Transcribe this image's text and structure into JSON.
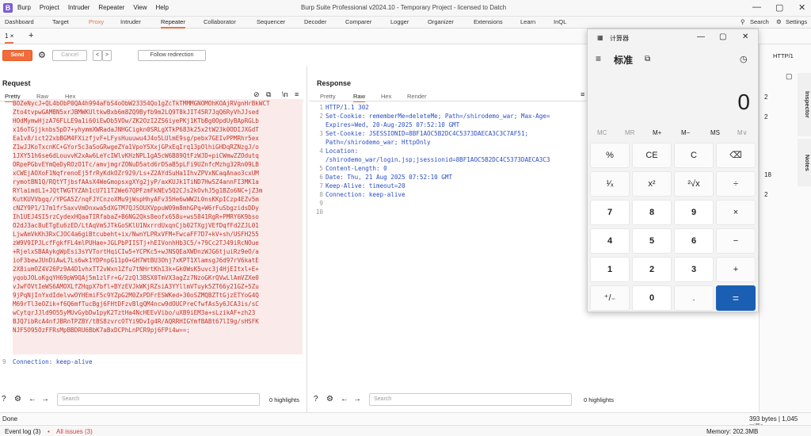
{
  "app": {
    "logo": "B",
    "menu": [
      "Burp",
      "Project",
      "Intruder",
      "Repeater",
      "View",
      "Help"
    ],
    "title": "Burp Suite Professional v2024.10 - Temporary Project - licensed to Datch",
    "minimize": "—",
    "maximize": "▢",
    "close": "✕"
  },
  "main_tabs": [
    "Dashboard",
    "Target",
    "Proxy",
    "Intruder",
    "Repeater",
    "Collaborator",
    "Sequencer",
    "Decoder",
    "Comparer",
    "Logger",
    "Organizer",
    "Extensions",
    "Learn",
    "InQL"
  ],
  "search_label": "Search",
  "settings_label": "Settings",
  "repeater_tab": {
    "label": "1 ×",
    "add": "+"
  },
  "toolbar": {
    "send": "Send",
    "cancel": "Cancel",
    "prev": "<",
    "next": ">",
    "follow": "Follow redirection",
    "http": "HTTP/1"
  },
  "request": {
    "title": "Request",
    "tabs": [
      "Pretty",
      "Raw",
      "Hex"
    ],
    "lines": [
      "BOZeNycJ+QL4bObP0QA4h994aFbS4oObW23354Qo1gZcTkTMMMGNOMOhKOAjRVgnHrBkWCT",
      "Zto4tvpwGAMBN5xrJBMWKUltkwBxb6m8ZQ9Byfb9m2LQ9T8kJIT45R7JqQ6RyVhJJsed",
      "HOdMymwHjzA76FLLE9a1i60iEwDb5VOw/ZK2OzI2ZS6iyePKj1KTbBg0OpdUyBApRGLb",
      "x16oTGjjknbs5pD7+yhymmXWRadaJNHGCigkn0SRLgXTkP683k25x2tW23k0ODIJXGdT",
      "Ea1v8/ict22xbBGM4FXizfjvF+LFysHuuuwu4J4o5LUlmE9sg/pebx7GEIvPPMRhr5ex",
      "Z1wJJKoTxcnKC+GYor5c3aSoGRwgeZYa1VpoYSXxjGPxEqIrq13pOlhiGHDqRZNzgJ/o",
      "1JXY51h6se6dLouvvK2xAw6LeYcIWlvKHzNPL1gA5cW6B89QtFzWJD+piCWmwZZOdutq",
      "ORpePGbvEYmQeDyROzO1Tc/amvjmgrZONuD5atd6rDSaB5pLFi9UZnfcMzhg32Rn09LB",
      "xCWEjAOXoF1NqfrenoEj5frRyKdkOZr929/Ls+Z2AYdSuHa1IhvZPVxNCaqAnao3cxUM",
      "rymotBN1Q/RQtYTjbsfAAsX4WeGmopsxgXYg2jyP/axKUJk1TiND7HwSZ4annFI3MK1a",
      "RYlaimdL1+JQtTWGTYZAh1cU711T2We67QPFzmFkNEv5Q2CJs2kOvhJ5g1BZo6NC+jZ3m",
      "KutKUVVbgq//YPGA5Z/nqFJYCnzoXMu9jWspHhyAFv35He6wWW2L0nsKKpICzp4EZv5m",
      "cNZY9P1/17m1fr5axvVmDnxwa5dXGTM7QJSOUXVppuW09m8mhGPq+W6rFuSbgzidsDDy",
      "Ih1UEJ4SI5rzCydexHQaaTIRfabaZ+B6NG2Qks8eofx658u+ws5841RgR+PMRY6K9bso",
      "O2dJ3ac8uETgEu6zED/LtAqVmSJTkGoSKlU1NxrrdUxqnCjb02TXgjVEfDqfFd2ZJL01",
      "LjwAmVkKh3RxCJOC4a6giBtcubeht+ix/NwnYLPRxVFM+FwcaFF7D7+kV+sh/USFH255",
      "zW9V9IPJLcfFgkfFL4mlPUHae+JGLPbPIISTj+hEIVonhHb3C5/+79Cc2TJ49iRcNOue",
      "+RjelxSBAAykgWpEsi3sYVTortHqiCIw5+YCPKc5+wJNSQEaXWDnzWJG6tjuiRz9eO/a",
      "ioF3bewJUnDiAwL7Ls6wk1YDPnpG11p0+GH7WtBU3Ohj7xKPT1XlamsgJ6d97rV6katE",
      "2X8iumOZ4V26Pz9A4D1vhxTT2vWxn1Zfu7tNHrtKh13k+Gk0WsK5uvc3j4HjEItxl+E+",
      "yqobJOLoKgqYH69pW9QAj5m1zlFr+G/2zQl3BSX0TmVX3agZz7NzoGKrQVwLlAmVZXe0",
      "vJwFOVtIeWS6AMOXLfZHqpX7bfl+BYzEVJkWKjRZsiA3YYllmVTuyk5ZT66y21GZ+5Zu",
      "9jPqNjInYxdIdelvwOYHEmiF5c9YZpG2M0ZxPDFrESWKed+30oSZMQBZTtGjzETYoG4Q",
      "M69rTl3eOZik+f6Q6mfTucBgj6FHtDFzvBlgQM4ncw9dOUCPreCfwfAs5y6JCA3is/sC",
      "wCytqrJJld9O55yMUvGybDw1pyK2TztHa4NcHEEvVibo/uXB9iEM3a+sLzikAF+zh23",
      "BJQ7ibRcA4nfJBRnTPZBY/tBS8zvrcOTYi9DvIg4R/AQRRHIGYmfBABt67lI9g/sHSFK",
      "NJF5O95OzFFRsMpBBDRU6BbK7aBxDCPhLnPCR9pj6FPi4w==;"
    ],
    "last_line_no": "9",
    "last_line": "Connection: keep-alive"
  },
  "response": {
    "title": "Response",
    "tabs": [
      "Pretty",
      "Raw",
      "Hex",
      "Render"
    ],
    "line_nos": [
      "1",
      "2",
      "",
      "3",
      "",
      "4",
      "",
      "5",
      "6",
      "7",
      "8",
      "9",
      "10"
    ],
    "lines": [
      "HTTP/1.1 302",
      "Set-Cookie: rememberMe=deleteMe; Path=/shirodemo_war; Max-Age=",
      "Expires=Wed, 20-Aug-2025 07:52:10 GMT",
      "Set-Cookie: JSESSIONID=8BF1AOC5B2DC4C5373DAECA3C3C7AF51;",
      "Path=/shirodemo_war; HttpOnly",
      "Location:",
      "/shirodemo_war/login.jsp;jsessionid=8BF1AOC5B2DC4C5373DAECA3C3",
      "Content-Length: 0",
      "Date: Thu, 21 Aug 2025 07:52:10 GMT",
      "Keep-Alive: timeout=20",
      "Connection: keep-alive",
      "",
      ""
    ]
  },
  "search_placeholder": "Search",
  "highlights": "0 highlights",
  "status": {
    "left": "Done",
    "right": "393 bytes | 1,045 millis"
  },
  "bottom": {
    "event_log": "Event log (3)",
    "all_issues": "All issues (3)",
    "memory": "Memory: 202.3MB"
  },
  "right_panel": {
    "inspector": "Inspector",
    "notes": "Notes",
    "nums": [
      "2",
      "2",
      "18",
      "2"
    ]
  },
  "calculator": {
    "title": "计算器",
    "mode": "标准",
    "display": "0",
    "memory": [
      "MC",
      "MR",
      "M+",
      "M−",
      "MS",
      "M∨"
    ],
    "keys": [
      "%",
      "CE",
      "C",
      "⌫",
      "¹⁄ₓ",
      "x²",
      "²√x",
      "÷",
      "7",
      "8",
      "9",
      "×",
      "4",
      "5",
      "6",
      "−",
      "1",
      "2",
      "3",
      "+",
      "⁺/₋",
      "0",
      ".",
      "="
    ]
  }
}
